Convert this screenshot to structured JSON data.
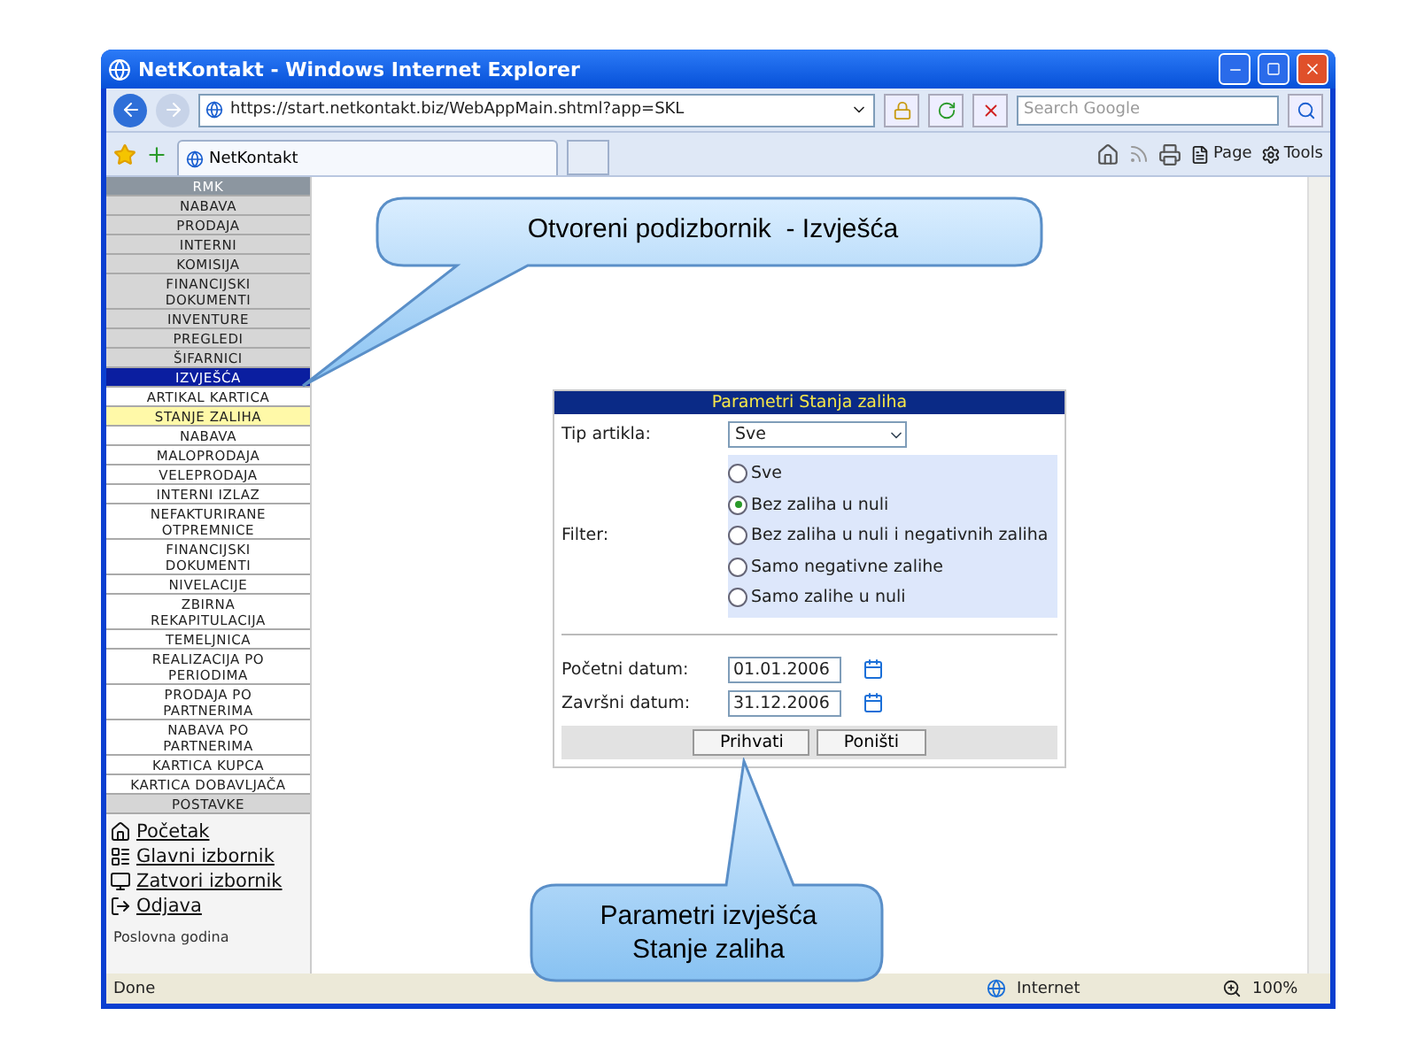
{
  "window": {
    "title": "NetKontakt - Windows Internet Explorer"
  },
  "address_bar": {
    "url": "https://start.netkontakt.biz/WebAppMain.shtml?app=SKL",
    "search_placeholder": "Search Google"
  },
  "tab": {
    "label": "NetKontakt"
  },
  "command_bar": [
    "Page",
    "Tools"
  ],
  "sidebar": {
    "header": "RMK",
    "items": [
      {
        "label": "NABAVA",
        "selected": false
      },
      {
        "label": "PRODAJA",
        "selected": false
      },
      {
        "label": "INTERNI",
        "selected": false
      },
      {
        "label": "KOMISIJA",
        "selected": false
      },
      {
        "label": "FINANCIJSKI DOKUMENTI",
        "selected": false
      },
      {
        "label": "INVENTURE",
        "selected": false
      },
      {
        "label": "PREGLEDI",
        "selected": false
      },
      {
        "label": "ŠIFARNICI",
        "selected": false
      },
      {
        "label": "IZVJEŠĆA",
        "selected": true,
        "children": [
          {
            "label": "ARTIKAL KARTICA",
            "selected": false
          },
          {
            "label": "STANJE ZALIHA",
            "selected": true
          },
          {
            "label": "NABAVA",
            "selected": false
          },
          {
            "label": "MALOPRODAJA",
            "selected": false
          },
          {
            "label": "VELEPRODAJA",
            "selected": false
          },
          {
            "label": "INTERNI IZLAZ",
            "selected": false
          },
          {
            "label": "NEFAKTURIRANE OTPREMNICE",
            "selected": false
          },
          {
            "label": "FINANCIJSKI DOKUMENTI",
            "selected": false
          },
          {
            "label": "NIVELACIJE",
            "selected": false
          },
          {
            "label": "ZBIRNA REKAPITULACIJA",
            "selected": false
          },
          {
            "label": "TEMELJNICA",
            "selected": false
          },
          {
            "label": "REALIZACIJA PO PERIODIMA",
            "selected": false
          },
          {
            "label": "PRODAJA PO PARTNERIMA",
            "selected": false
          },
          {
            "label": "NABAVA PO PARTNERIMA",
            "selected": false
          },
          {
            "label": "KARTICA KUPCA",
            "selected": false
          },
          {
            "label": "KARTICA DOBAVLJAČA",
            "selected": false
          }
        ]
      },
      {
        "label": "POSTAVKE",
        "selected": false
      }
    ],
    "links": [
      {
        "label": "Početak",
        "kind": "home"
      },
      {
        "label": "Glavni izbornik",
        "kind": "main"
      },
      {
        "label": "Zatvori izbornik",
        "kind": "close"
      },
      {
        "label": "Odjava",
        "kind": "logout"
      }
    ],
    "footer": "Poslovna godina"
  },
  "dialog": {
    "title": "Parametri Stanja zaliha",
    "item_type": {
      "label": "Tip artikla:",
      "value": "Sve"
    },
    "filter": {
      "label": "Filter:",
      "options": [
        {
          "label": "Sve",
          "selected": false
        },
        {
          "label": "Bez zaliha u nuli",
          "selected": true
        },
        {
          "label": "Bez zaliha u nuli i negativnih zaliha",
          "selected": false
        },
        {
          "label": "Samo negativne zalihe",
          "selected": false
        },
        {
          "label": "Samo zalihe u nuli",
          "selected": false
        }
      ]
    },
    "start_date": {
      "label": "Početni datum:",
      "value": "01.01.2006"
    },
    "end_date": {
      "label": "Završni datum:",
      "value": "31.12.2006"
    },
    "buttons": [
      "Prihvati",
      "Poništi"
    ]
  },
  "callouts": [
    {
      "kind": "top",
      "lines": [
        "Otvoreni podizbornik  - Izvješća"
      ]
    },
    {
      "kind": "bottom",
      "lines": [
        "Parametri izvješća",
        "Stanje zaliha"
      ]
    }
  ],
  "status_bar": {
    "text": "Done",
    "zone": "Internet",
    "zoom": "100%"
  }
}
